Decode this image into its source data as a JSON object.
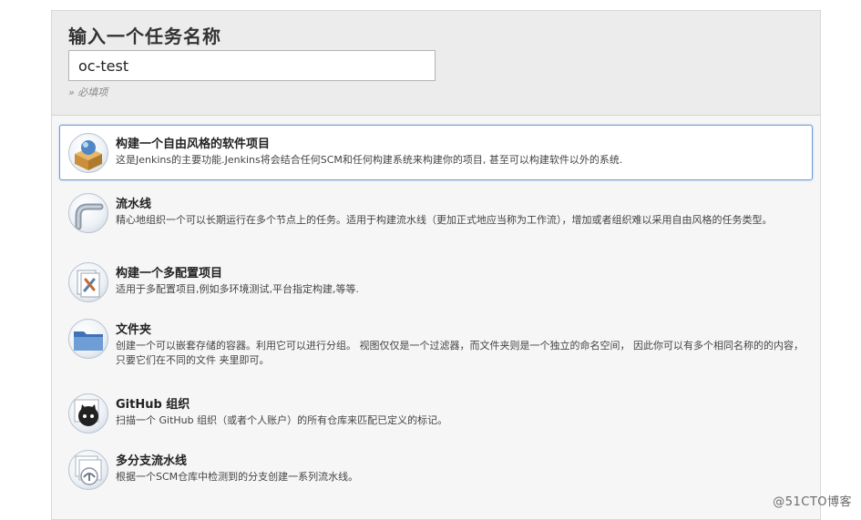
{
  "header": {
    "title": "输入一个任务名称",
    "name_value": "oc-test",
    "required_note": "» 必填项"
  },
  "job_types": [
    {
      "name": "构建一个自由风格的软件项目",
      "description": "这是Jenkins的主要功能.Jenkins将会结合任何SCM和任何构建系统来构建你的项目, 甚至可以构建软件以外的系统.",
      "icon": "freestyle-box-icon",
      "selected": true
    },
    {
      "name": "流水线",
      "description": "精心地组织一个可以长期运行在多个节点上的任务。适用于构建流水线（更加正式地应当称为工作流），增加或者组织难以采用自由风格的任务类型。",
      "icon": "pipeline-icon",
      "selected": false
    },
    {
      "name": "构建一个多配置项目",
      "description": "适用于多配置项目,例如多环境测试,平台指定构建,等等.",
      "icon": "multi-config-icon",
      "selected": false
    },
    {
      "name": "文件夹",
      "description": "创建一个可以嵌套存储的容器。利用它可以进行分组。 视图仅仅是一个过滤器，而文件夹则是一个独立的命名空间， 因此你可以有多个相同名称的的内容，只要它们在不同的文件 夹里即可。",
      "icon": "folder-icon",
      "selected": false
    },
    {
      "name": "GitHub 组织",
      "description": "扫描一个 GitHub 组织（或者个人账户）的所有仓库来匹配已定义的标记。",
      "icon": "github-octocat-icon",
      "selected": false
    },
    {
      "name": "多分支流水线",
      "description": "根据一个SCM仓库中检测到的分支创建一系列流水线。",
      "icon": "multibranch-pipeline-icon",
      "selected": false
    }
  ],
  "watermark": "@51CTO博客",
  "colors": {
    "selected_border": "#6f9ed6",
    "panel_background": "#f6f6f6",
    "header_background": "#ececec"
  }
}
